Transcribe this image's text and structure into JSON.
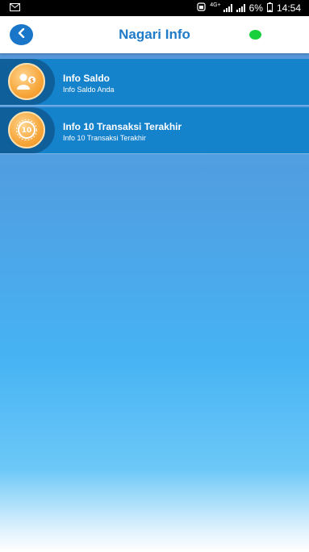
{
  "status_bar": {
    "network_label": "4G+",
    "battery_percent": "6%",
    "time": "14:54"
  },
  "header": {
    "title": "Nagari Info",
    "status_color": "#18d03c"
  },
  "menu": {
    "items": [
      {
        "title": "Info Saldo",
        "subtitle": "Info Saldo Anda",
        "icon": "user-balance-icon"
      },
      {
        "title": "Info 10 Transaksi Terakhir",
        "subtitle": "Info 10 Transaksi Terakhir",
        "icon": "ten-transactions-icon"
      }
    ]
  },
  "colors": {
    "accent": "#1f7bc8",
    "item_background": "#1582cc",
    "icon_orange": "#f7a63a"
  }
}
